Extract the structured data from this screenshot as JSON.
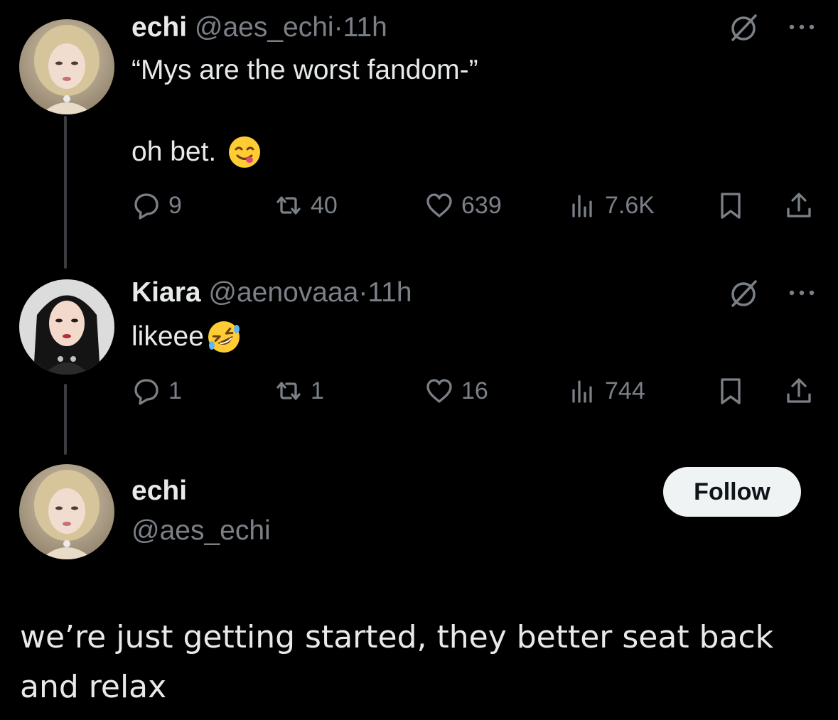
{
  "tweets": [
    {
      "display_name": "echi",
      "handle": "@aes_echi",
      "dot": "·",
      "time": "11h",
      "text_line1": "“Mys are the worst fandom-”",
      "text_line2": "oh bet.",
      "replies": "9",
      "reposts": "40",
      "likes": "639",
      "views": "7.6K"
    },
    {
      "display_name": "Kiara",
      "handle": "@aenovaaa",
      "dot": "·",
      "time": "11h",
      "text": "likeee",
      "replies": "1",
      "reposts": "1",
      "likes": "16",
      "views": "744"
    }
  ],
  "main_post": {
    "display_name": "echi",
    "handle": "@aes_echi",
    "follow_label": "Follow",
    "text": "we’re just getting started, they better seat back and relax"
  },
  "colors": {
    "background": "#000000",
    "text": "#e7e9ea",
    "muted": "#7b8087",
    "follow_bg": "#eff3f4"
  },
  "icons": [
    "grok-icon",
    "more-icon",
    "reply-icon",
    "repost-icon",
    "like-icon",
    "views-icon",
    "bookmark-icon",
    "share-icon"
  ]
}
